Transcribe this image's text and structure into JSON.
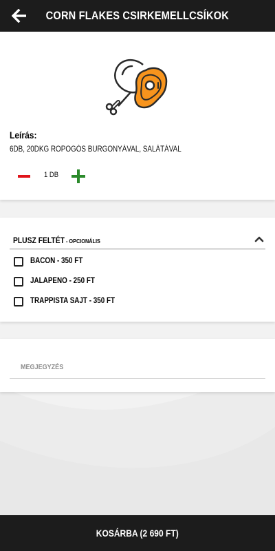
{
  "header": {
    "title": "Corn Flakes csirkemellcsíkok",
    "back_icon": "arrow-left-icon"
  },
  "product": {
    "icon": "chicken-leg-meat-icon",
    "icon_accent": "#f7941d",
    "description_label": "Leírás:",
    "description": "6db, 20dkg ropogós burgonyával, salátával",
    "quantity": "1 db"
  },
  "extras": {
    "title": "Plusz feltét",
    "subtitle": " - Opcionális",
    "options": [
      {
        "label": "Bacon - 350 Ft",
        "checked": false
      },
      {
        "label": "Jalapeno - 250 Ft",
        "checked": false
      },
      {
        "label": "Trappista sajt - 350 Ft",
        "checked": false
      }
    ]
  },
  "note": {
    "placeholder": "Megjegyzés"
  },
  "footer": {
    "cart_label": "Kosárba (2 690 Ft)"
  },
  "colors": {
    "header_bg": "#1c1c1c",
    "minus": "#e0141b",
    "plus": "#2b8a2b",
    "accent": "#f7941d"
  }
}
